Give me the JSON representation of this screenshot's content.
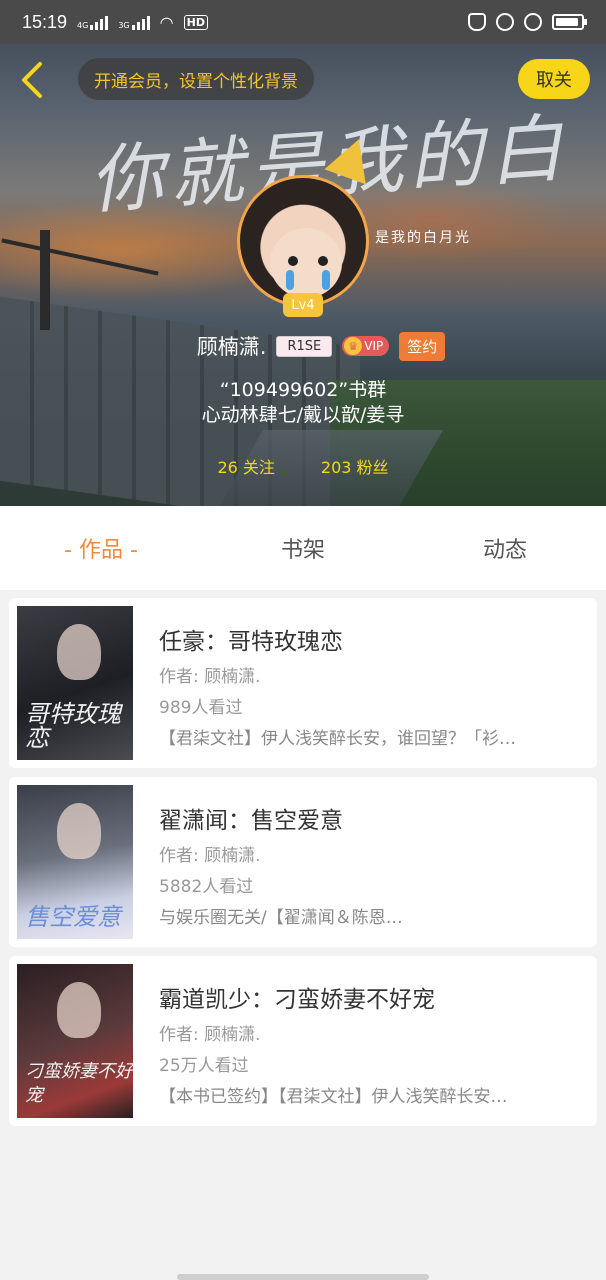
{
  "status_bar": {
    "time": "15:19",
    "net1": "4G",
    "net2": "3G",
    "hd_label": "HD",
    "battery_level": 0.85
  },
  "header": {
    "back_icon": "chevron-left-icon",
    "vip_banner": "开通会员，设置个性化背景",
    "follow_button": "取关",
    "hero_calligraphy": "你就是我的白月光",
    "hero_caption": "是我的白月光"
  },
  "profile": {
    "level": "Lv4",
    "username": "顾楠潇.",
    "name_tag": "R1SE",
    "vip_label": "VIP",
    "sign_label": "签约",
    "bio_line1": "“109499602”书群",
    "bio_line2": "心动林肆七/戴以歆/姜寻",
    "following": "26 关注",
    "followers": "203 粉丝"
  },
  "tabs": [
    {
      "label": "- 作品 -",
      "active": true
    },
    {
      "label": "书架",
      "active": false
    },
    {
      "label": "动态",
      "active": false
    }
  ],
  "books": [
    {
      "title": "任豪：哥特玫瑰恋",
      "author": "作者: 顾楠潇.",
      "views": "989人看过",
      "desc": "【君柒文社】伊人浅笑醉长安，谁回望？「衫…",
      "cover_text": "哥特玫瑰恋"
    },
    {
      "title": "翟潇闻：售空爱意",
      "author": "作者: 顾楠潇.",
      "views": "5882人看过",
      "desc": "与娱乐圈无关/【翟潇闻＆陈恩…",
      "cover_text": "售空爱意"
    },
    {
      "title": "霸道凯少：刁蛮娇妻不好宠",
      "author": "作者: 顾楠潇.",
      "views": "25万人看过",
      "desc": "【本书已签约】【君柒文社】伊人浅笑醉长安…",
      "cover_text": "刁蛮娇妻不好宠"
    }
  ],
  "colors": {
    "accent_orange": "#f28a3c",
    "follow_yellow": "#f7d61a",
    "banner_text": "#f5c526"
  }
}
